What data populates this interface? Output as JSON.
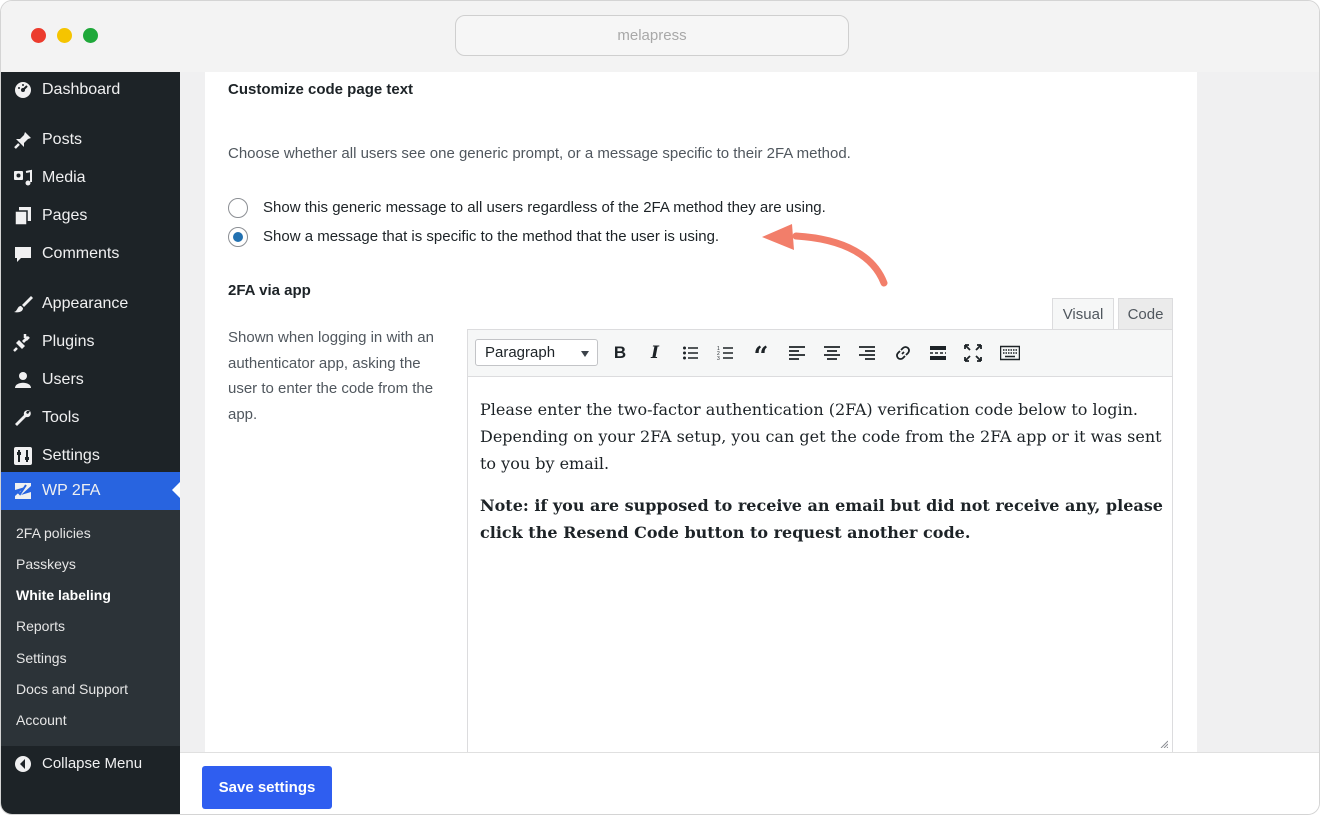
{
  "browser": {
    "url_text": "melapress"
  },
  "sidebar": {
    "items": [
      {
        "label": "Dashboard",
        "icon": "dashboard-icon"
      },
      {
        "label": "Posts",
        "icon": "pushpin-icon"
      },
      {
        "label": "Media",
        "icon": "media-icon"
      },
      {
        "label": "Pages",
        "icon": "pages-icon"
      },
      {
        "label": "Comments",
        "icon": "comment-icon"
      },
      {
        "label": "Appearance",
        "icon": "paintbrush-icon"
      },
      {
        "label": "Plugins",
        "icon": "plug-icon"
      },
      {
        "label": "Users",
        "icon": "user-icon"
      },
      {
        "label": "Tools",
        "icon": "wrench-icon"
      },
      {
        "label": "Settings",
        "icon": "settings-sliders-icon"
      },
      {
        "label": "WP 2FA",
        "icon": "wp2fa-logo-icon"
      }
    ],
    "submenu": [
      {
        "label": "2FA policies"
      },
      {
        "label": "Passkeys"
      },
      {
        "label": "White labeling"
      },
      {
        "label": "Reports"
      },
      {
        "label": "Settings"
      },
      {
        "label": "Docs and Support"
      },
      {
        "label": "Account"
      }
    ],
    "collapse_label": "Collapse Menu",
    "active_color": "#2864e0"
  },
  "main": {
    "section_title": "Customize code page text",
    "section_desc": "Choose whether all users see one generic prompt, or a message specific to their 2FA method.",
    "radio_options": [
      {
        "label": "Show this generic message to all users regardless of the 2FA method they are using.",
        "checked": false
      },
      {
        "label": "Show a message that is specific to the method that the user is using.",
        "checked": true
      }
    ],
    "app_section_title": "2FA via app",
    "app_help_text": "Shown when logging in with an authenticator app, asking the user to enter the code from the app.",
    "editor": {
      "tabs": {
        "visual": "Visual",
        "code": "Code"
      },
      "format_select": "Paragraph",
      "toolbar_icons": [
        "bold-icon",
        "italic-icon",
        "bullet-list-icon",
        "numbered-list-icon",
        "blockquote-icon",
        "align-left-icon",
        "align-center-icon",
        "align-right-icon",
        "link-icon",
        "read-more-icon",
        "fullscreen-icon",
        "toolbar-toggle-icon"
      ],
      "toolbar_glyphs": {
        "bold": "B",
        "italic": "I",
        "quote": "“"
      },
      "content_p1": "Please enter the two-factor authentication (2FA) verification code below to login. Depending on your 2FA setup, you can get the code from the 2FA app or it was sent to you by email.",
      "content_p2": "Note: if you are supposed to receive an email but did not receive any, please click the Resend Code button to request another code."
    }
  },
  "footer": {
    "save_label": "Save settings",
    "button_color": "#2f5ef0"
  },
  "annotation": {
    "arrow_color": "#f27e6a"
  }
}
